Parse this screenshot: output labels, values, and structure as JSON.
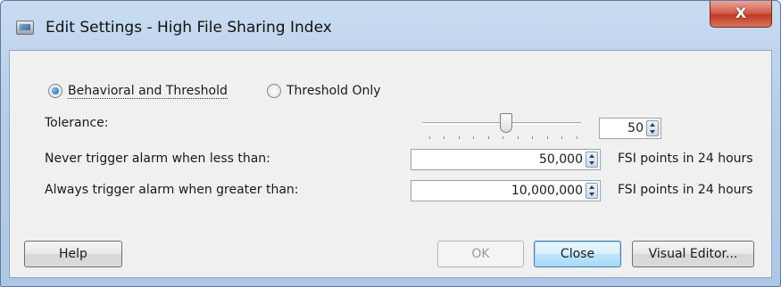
{
  "window": {
    "title": "Edit Settings - High File Sharing Index",
    "close_glyph": "X",
    "icon": "settings-app-icon"
  },
  "mode": {
    "options": [
      {
        "label": "Behavioral and Threshold",
        "checked": true
      },
      {
        "label": "Threshold Only",
        "checked": false
      }
    ]
  },
  "tolerance": {
    "label": "Tolerance:",
    "value": "50",
    "slider_fraction": 0.5
  },
  "never_trigger": {
    "label": "Never trigger alarm when less than:",
    "value": "50,000",
    "unit": "FSI points in 24 hours"
  },
  "always_trigger": {
    "label": "Always trigger alarm when greater than:",
    "value": "10,000,000",
    "unit": "FSI points in 24 hours"
  },
  "buttons": {
    "help": "Help",
    "ok": "OK",
    "close": "Close",
    "visual_editor": "Visual Editor..."
  },
  "colors": {
    "titlebar": "#b6cde9",
    "close_button": "#c13b22",
    "default_button": "#bee6fd"
  }
}
